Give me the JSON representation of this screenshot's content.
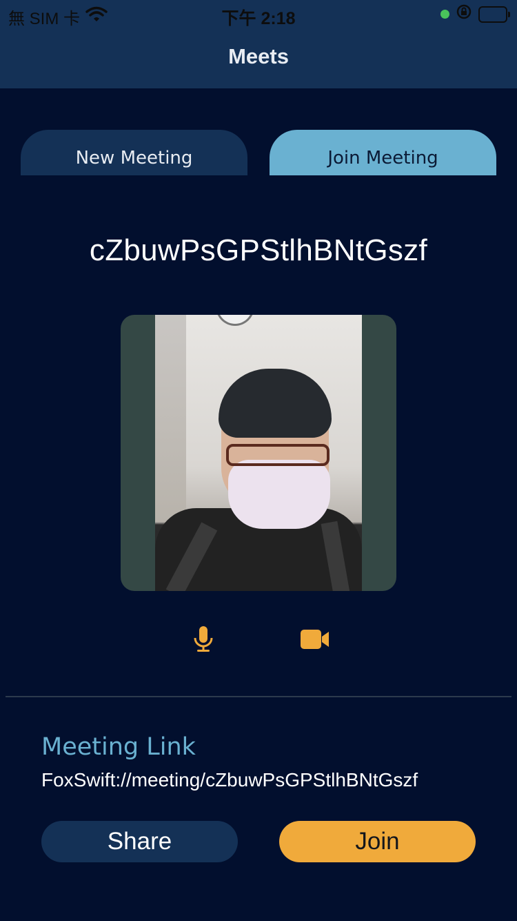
{
  "status_bar": {
    "carrier": "無 SIM 卡",
    "time": "下午 2:18"
  },
  "nav": {
    "title": "Meets"
  },
  "tabs": [
    {
      "label": "New Meeting",
      "selected": false
    },
    {
      "label": "Join Meeting",
      "selected": true
    }
  ],
  "meeting": {
    "code": "cZbuwPsGPStlhBNtGszf"
  },
  "controls": {
    "mic_icon": "microphone-icon",
    "camera_icon": "video-camera-icon",
    "accent": "#f0aa3b"
  },
  "link_section": {
    "title": "Meeting Link",
    "url": "FoxSwift://meeting/cZbuwPsGPStlhBNtGszf"
  },
  "actions": {
    "share_label": "Share",
    "join_label": "Join"
  },
  "colors": {
    "background": "#020f2e",
    "panel": "#143156",
    "highlight": "#6ab1d1",
    "accent": "#f0aa3b"
  }
}
